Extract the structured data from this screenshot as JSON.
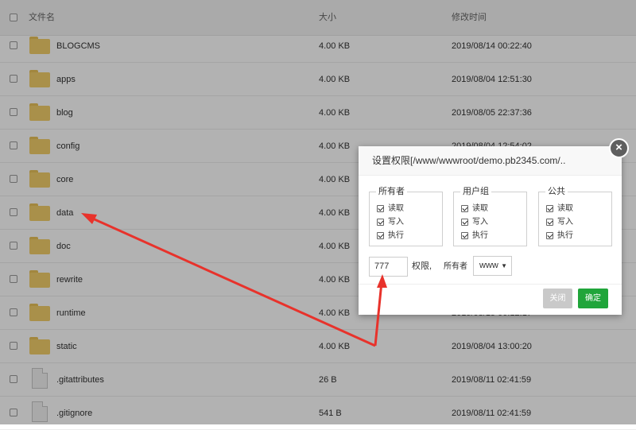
{
  "header": {
    "name_col": "文件名",
    "size_col": "大小",
    "time_col": "修改时间"
  },
  "files": [
    {
      "name": "BLOGCMS",
      "size": "4.00 KB",
      "time": "2019/08/14 00:22:40",
      "type": "folder"
    },
    {
      "name": "apps",
      "size": "4.00 KB",
      "time": "2019/08/04 12:51:30",
      "type": "folder"
    },
    {
      "name": "blog",
      "size": "4.00 KB",
      "time": "2019/08/05 22:37:36",
      "type": "folder"
    },
    {
      "name": "config",
      "size": "4.00 KB",
      "time": "2019/08/04 12:54:02",
      "type": "folder"
    },
    {
      "name": "core",
      "size": "4.00 KB",
      "time": "",
      "type": "folder"
    },
    {
      "name": "data",
      "size": "4.00 KB",
      "time": "",
      "type": "folder"
    },
    {
      "name": "doc",
      "size": "4.00 KB",
      "time": "",
      "type": "folder"
    },
    {
      "name": "rewrite",
      "size": "4.00 KB",
      "time": "",
      "type": "folder"
    },
    {
      "name": "runtime",
      "size": "4.00 KB",
      "time": "2019/08/15 00:12:17",
      "type": "folder"
    },
    {
      "name": "static",
      "size": "4.00 KB",
      "time": "2019/08/04 13:00:20",
      "type": "folder"
    },
    {
      "name": ".gitattributes",
      "size": "26 B",
      "time": "2019/08/11 02:41:59",
      "type": "file"
    },
    {
      "name": ".gitignore",
      "size": "541 B",
      "time": "2019/08/11 02:41:59",
      "type": "file"
    }
  ],
  "dialog": {
    "title": "设置权限[/www/wwwroot/demo.pb2345.com/..",
    "close_icon": "×",
    "groups": [
      {
        "label": "所有者",
        "items": [
          "读取",
          "写入",
          "执行"
        ]
      },
      {
        "label": "用户组",
        "items": [
          "读取",
          "写入",
          "执行"
        ]
      },
      {
        "label": "公共",
        "items": [
          "读取",
          "写入",
          "执行"
        ]
      }
    ],
    "permission_value": "777",
    "permission_label": "权限,",
    "owner_label": "所有者",
    "owner_value": "www",
    "close_button": "关闭",
    "ok_button": "确定"
  },
  "colors": {
    "confirm_button": "#20a53a",
    "folder": "#f2cf6b",
    "annotation_arrow": "#e8322b"
  }
}
